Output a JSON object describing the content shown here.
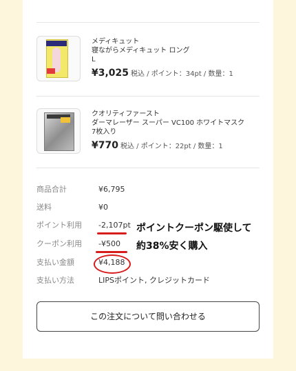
{
  "items": [
    {
      "brand": "メディキュット",
      "name": "寝ながらメディキュット ロング",
      "variant": "L",
      "price": "¥3,025",
      "meta": "税込 / ポイント：34pt / 数量：1",
      "image_icon": "compression-socks-package-icon"
    },
    {
      "brand": "クオリティファースト",
      "name": "ダーマレーザー スーパー VC100 ホワイトマスク",
      "variant": "7枚入り",
      "price": "¥770",
      "meta": "税込 / ポイント：22pt / 数量：1",
      "image_icon": "face-mask-package-icon"
    }
  ],
  "summary": {
    "subtotal": {
      "label": "商品合計",
      "value": "¥6,795"
    },
    "shipping": {
      "label": "送料",
      "value": "¥0"
    },
    "points": {
      "label": "ポイント利用",
      "value": "-2,107pt"
    },
    "coupon": {
      "label": "クーポン利用",
      "value": "-¥500"
    },
    "total": {
      "label": "支払い金額",
      "value": "¥4,188"
    },
    "method": {
      "label": "支払い方法",
      "value": "LIPSポイント, クレジットカード"
    }
  },
  "annotation": {
    "line1": "ポイントクーポン駆使して",
    "line2": "約38%安く購入"
  },
  "inquiry_button": "この注文について問い合わせる",
  "colors": {
    "background": "#fdf6dc",
    "annotation_red": "#d81b1b"
  }
}
